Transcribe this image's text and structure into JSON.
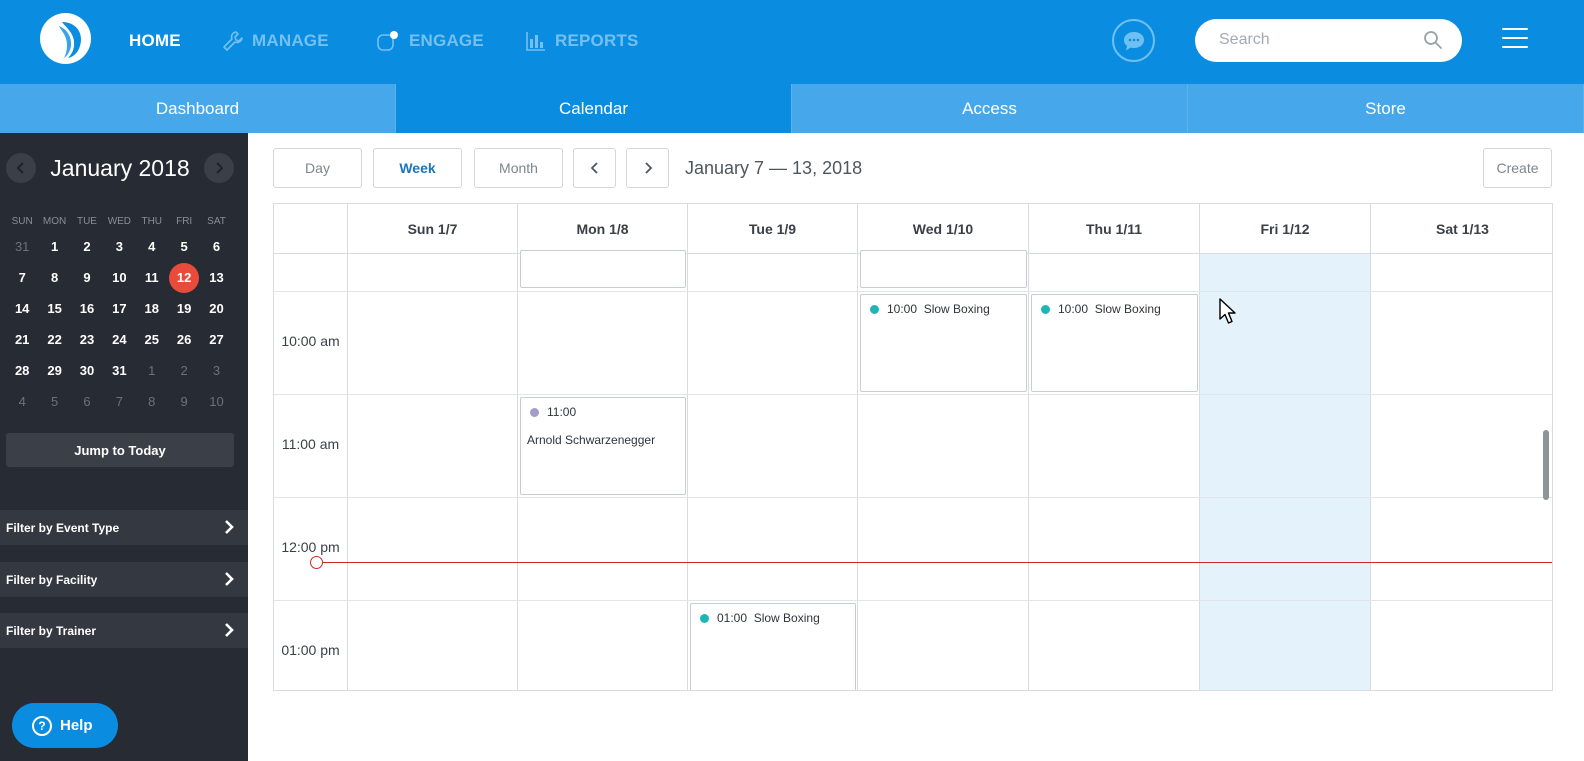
{
  "topnav": {
    "home": "HOME",
    "manage": "MANAGE",
    "engage": "ENGAGE",
    "reports": "REPORTS"
  },
  "search": {
    "placeholder": "Search"
  },
  "subnav": [
    "Dashboard",
    "Calendar",
    "Access",
    "Store"
  ],
  "mini_calendar": {
    "title": "January 2018",
    "dow": [
      "SUN",
      "MON",
      "TUE",
      "WED",
      "THU",
      "FRI",
      "SAT"
    ],
    "weeks": [
      [
        "31",
        "1",
        "2",
        "3",
        "4",
        "5",
        "6"
      ],
      [
        "7",
        "8",
        "9",
        "10",
        "11",
        "12",
        "13"
      ],
      [
        "14",
        "15",
        "16",
        "17",
        "18",
        "19",
        "20"
      ],
      [
        "21",
        "22",
        "23",
        "24",
        "25",
        "26",
        "27"
      ],
      [
        "28",
        "29",
        "30",
        "31",
        "1",
        "2",
        "3"
      ],
      [
        "4",
        "5",
        "6",
        "7",
        "8",
        "9",
        "10"
      ]
    ],
    "today": "12"
  },
  "sidebar": {
    "jump_today": "Jump to Today",
    "filters": [
      "Filter by Event Type",
      "Filter by Facility",
      "Filter by Trainer"
    ],
    "help": "Help"
  },
  "toolbar": {
    "views": [
      "Day",
      "Week",
      "Month"
    ],
    "active_view": "Week",
    "range": "January 7 — 13, 2018",
    "create": "Create"
  },
  "week": {
    "days": [
      "Sun 1/7",
      "Mon 1/8",
      "Tue 1/9",
      "Wed 1/10",
      "Thu 1/11",
      "Fri 1/12",
      "Sat 1/13"
    ],
    "highlighted_day": "Fri 1/12",
    "times": [
      "10:00 am",
      "11:00 am",
      "12:00 pm",
      "01:00 pm"
    ]
  },
  "events": [
    {
      "day": "Wed 1/10",
      "time": "10:00",
      "title": "Slow Boxing",
      "color": "#1fb5b8"
    },
    {
      "day": "Thu 1/11",
      "time": "10:00",
      "title": "Slow Boxing",
      "color": "#1fb5b8"
    },
    {
      "day": "Mon 1/8",
      "time": "11:00",
      "title": "",
      "subtitle": "Arnold Schwarzenegger",
      "color": "#a79bc7"
    },
    {
      "day": "Tue 1/9",
      "time": "01:00",
      "title": "Slow Boxing",
      "color": "#1fb5b8"
    }
  ],
  "colors": {
    "brand": "#0a8de1",
    "subnav": "#46a8ea",
    "sidebar": "#272b33",
    "today": "#e84b3a",
    "now_line": "#c62b2b",
    "highlight_column": "#e4f2fb"
  }
}
